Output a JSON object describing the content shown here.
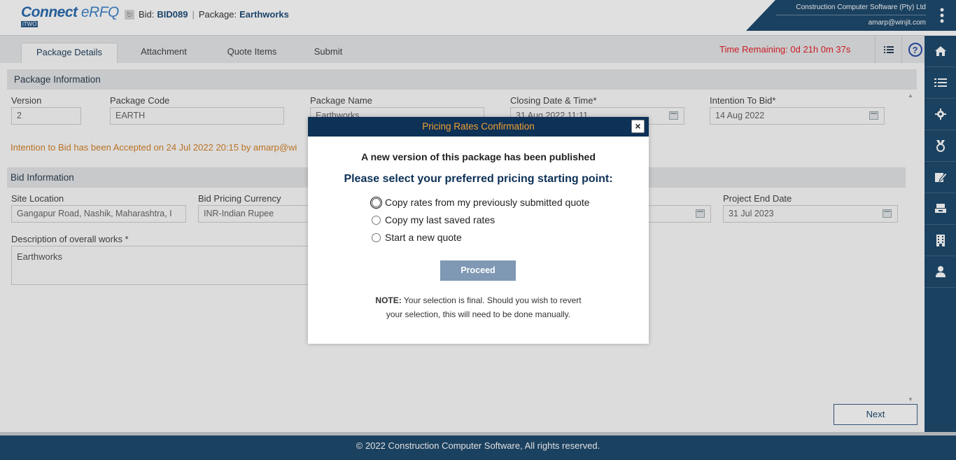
{
  "app": {
    "logo_main": "Connect",
    "logo_erfq": "eRFQ",
    "logo_sub": "iTWO",
    "bid_label": "Bid:",
    "bid_value": "BID089",
    "package_label": "Package:",
    "package_value": "Earthworks",
    "company": "Construction Computer Software (Pty) Ltd",
    "user_email": "amarp@winjit.com"
  },
  "tabs": [
    {
      "label": "Package Details"
    },
    {
      "label": "Attachment"
    },
    {
      "label": "Quote Items"
    },
    {
      "label": "Submit"
    }
  ],
  "time_remaining": "Time Remaining: 0d 21h 0m 37s",
  "package_info": {
    "title": "Package Information",
    "version_label": "Version",
    "version_value": "2",
    "code_label": "Package Code",
    "code_value": "EARTH",
    "name_label": "Package Name",
    "name_value": "Earthworks",
    "closing_label": "Closing Date & Time*",
    "closing_value": "31 Aug 2022 11:11",
    "intention_label": "Intention To Bid*",
    "intention_value": "14 Aug 2022"
  },
  "notice": "Intention to Bid has been Accepted on 24 Jul 2022 20:15 by amarp@wi",
  "bid_info": {
    "title": "Bid Information",
    "site_label": "Site Location",
    "site_value": "Gangapur Road, Nashik, Maharashtra, I",
    "currency_label": "Bid Pricing Currency",
    "currency_value": "INR-Indian Rupee",
    "end_label": "Project End Date",
    "end_value": "31 Jul 2023",
    "desc_label": "Description of overall works *",
    "desc_value": "Earthworks"
  },
  "next_label": "Next",
  "footer": "© 2022 Construction Computer Software, All rights reserved.",
  "modal": {
    "title": "Pricing Rates Confirmation",
    "close": "×",
    "subtitle": "A new version of this package has been published",
    "question": "Please select your preferred pricing starting point:",
    "options": [
      {
        "label": "Copy rates from my previously submitted quote"
      },
      {
        "label": "Copy my last saved rates"
      },
      {
        "label": "Start a new quote"
      }
    ],
    "proceed": "Proceed",
    "note_bold": "NOTE:",
    "note_text1": " Your selection is final. Should you wish to revert",
    "note_text2": "your selection, this will need to be done manually."
  },
  "sidebar_icons": [
    "home-icon",
    "list-icon",
    "gear-icon",
    "medal-icon",
    "edit-icon",
    "handshake-icon",
    "building-icon",
    "user-icon"
  ]
}
